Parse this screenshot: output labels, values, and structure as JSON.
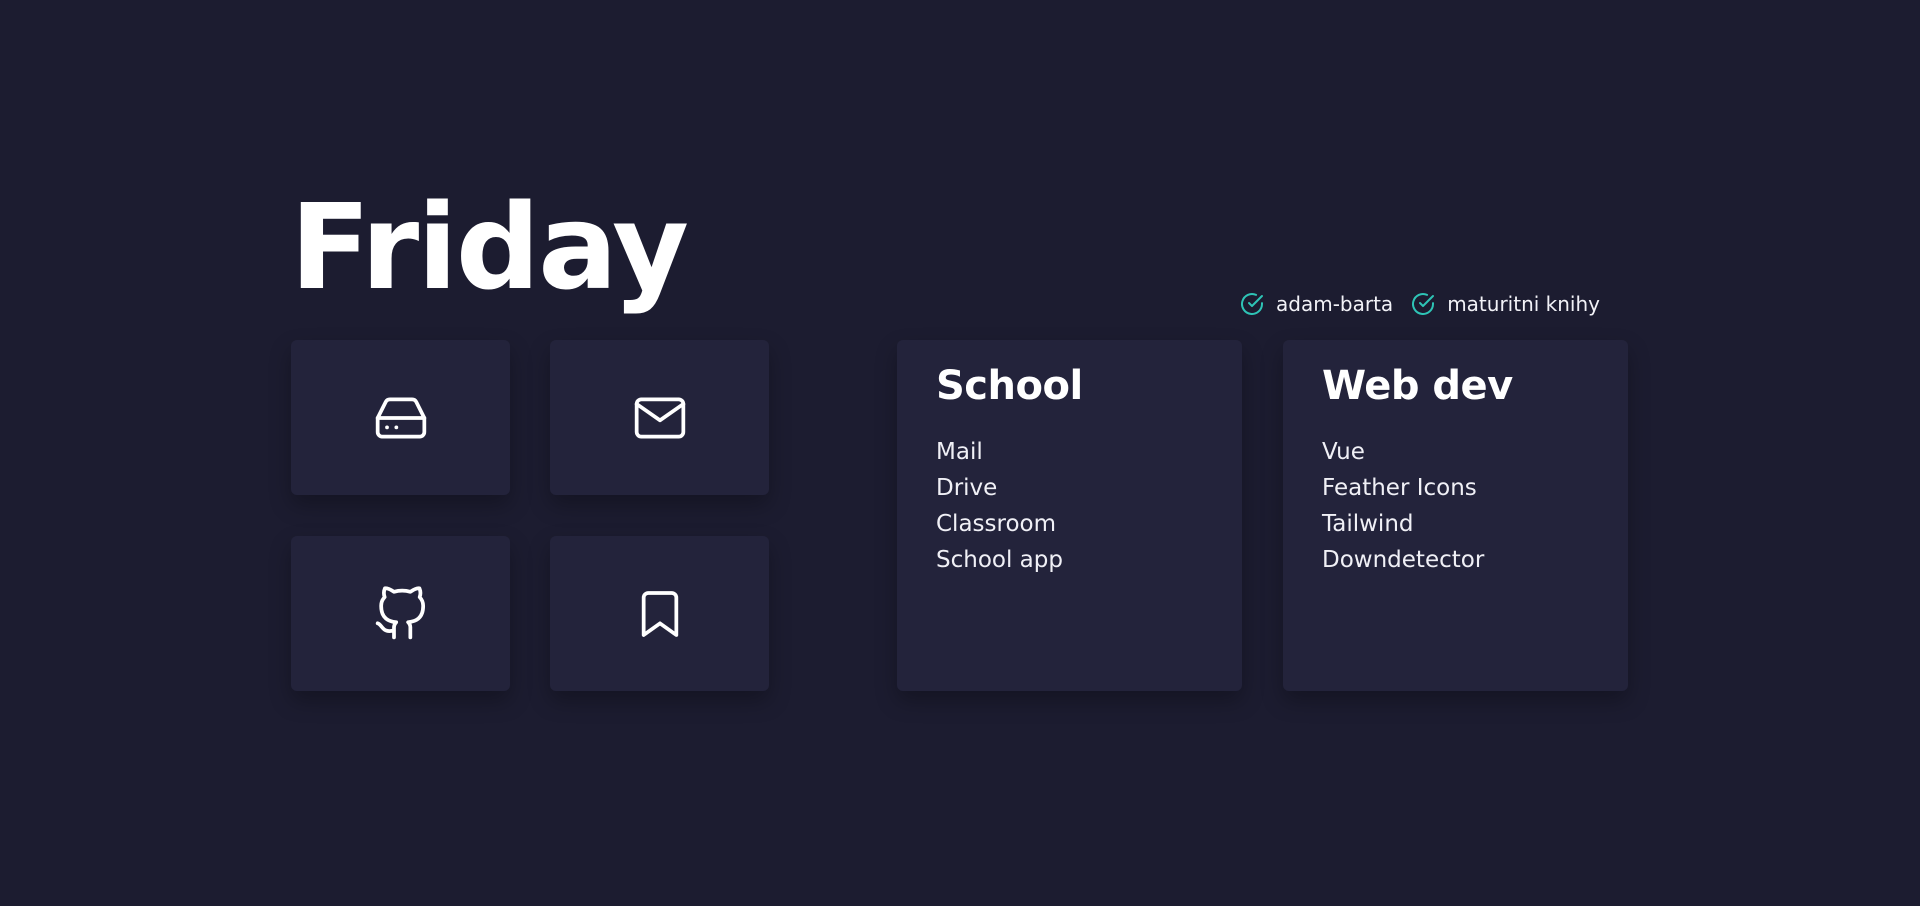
{
  "header": {
    "day": "Friday"
  },
  "status": {
    "items": [
      {
        "label": "adam-barta",
        "icon": "check-circle-icon"
      },
      {
        "label": "maturitni knihy",
        "icon": "check-circle-icon"
      }
    ],
    "check_color": "#2ec4b6"
  },
  "quick_links": [
    {
      "icon": "hard-drive-icon"
    },
    {
      "icon": "mail-icon"
    },
    {
      "icon": "github-icon"
    },
    {
      "icon": "bookmark-icon"
    }
  ],
  "cards": [
    {
      "title": "School",
      "links": [
        "Mail",
        "Drive",
        "Classroom",
        "School app"
      ]
    },
    {
      "title": "Web dev",
      "links": [
        "Vue",
        "Feather Icons",
        "Tailwind",
        "Downdetector"
      ]
    }
  ],
  "colors": {
    "background": "#1c1c30",
    "card": "#23233b",
    "text": "#ffffff"
  }
}
